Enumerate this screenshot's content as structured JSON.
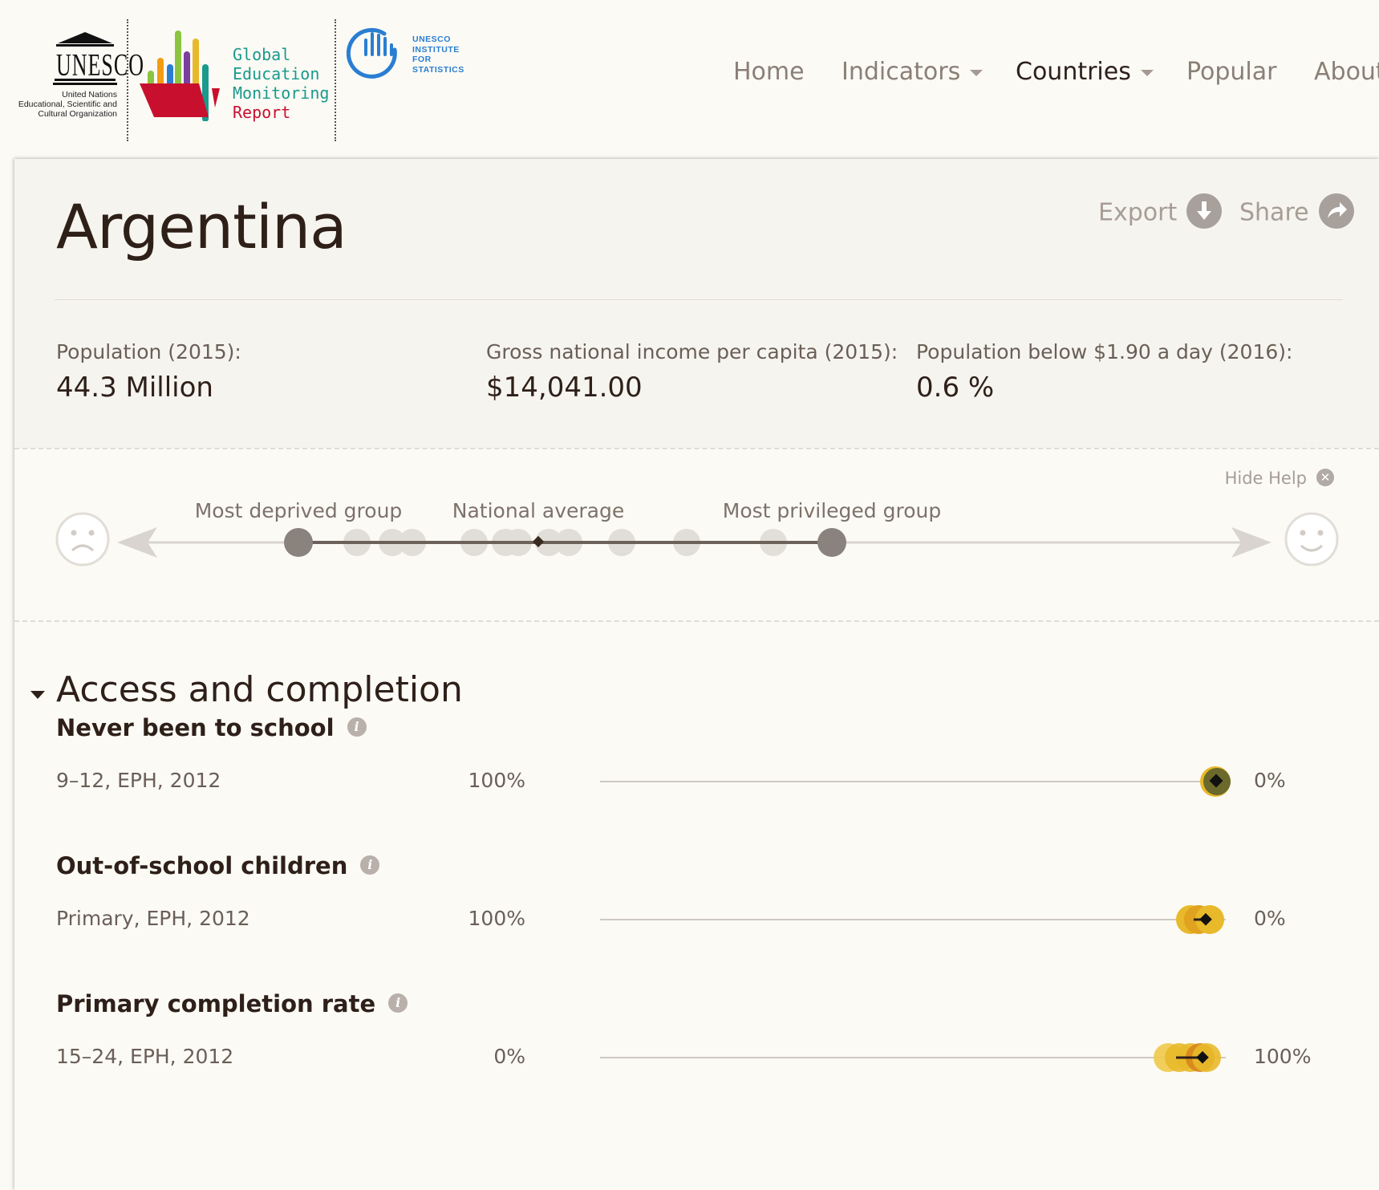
{
  "header": {
    "unesco": {
      "wordmark": "UNESCO",
      "subtitle_lines": [
        "United Nations",
        "Educational, Scientific and",
        "Cultural Organization"
      ]
    },
    "gem": {
      "line1": "Global",
      "line2": "Education",
      "line3": "Monitoring",
      "line4": "Report"
    },
    "uis": {
      "line1": "UNESCO",
      "line2": "INSTITUTE",
      "line3": "FOR",
      "line4": "STATISTICS"
    },
    "nav": {
      "home": "Home",
      "indicators": "Indicators",
      "countries": "Countries",
      "popular": "Popular",
      "about": "About"
    }
  },
  "country": {
    "name": "Argentina",
    "export_label": "Export",
    "share_label": "Share",
    "stats": [
      {
        "label": "Population (2015):",
        "value": "44.3 Million"
      },
      {
        "label": "Gross national income per capita (2015):",
        "value": "$14,041.00"
      },
      {
        "label": "Population below $1.90 a day (2016):",
        "value": "0.6 %"
      }
    ]
  },
  "help": {
    "hide_label": "Hide Help",
    "most_deprived": "Most deprived group",
    "national_average": "National average",
    "most_privileged": "Most privileged group"
  },
  "section": {
    "title": "Access and completion",
    "indicators": [
      {
        "title": "Never been to school",
        "subtitle": "9–12, EPH, 2012",
        "left": "100%",
        "right": "0%",
        "value": 0
      },
      {
        "title": "Out-of-school children",
        "subtitle": "Primary, EPH, 2012",
        "left": "100%",
        "right": "0%",
        "value": 1
      },
      {
        "title": "Primary completion rate",
        "subtitle": "15–24, EPH, 2012",
        "left": "0%",
        "right": "100%",
        "value": 98
      }
    ]
  },
  "colors": {
    "accent_dark": "#2e2019",
    "muted": "#8a7f76",
    "dot_olive": "#6b6a2c",
    "dot_yellow": "#e8b92a",
    "dot_orange": "#d9851b"
  }
}
